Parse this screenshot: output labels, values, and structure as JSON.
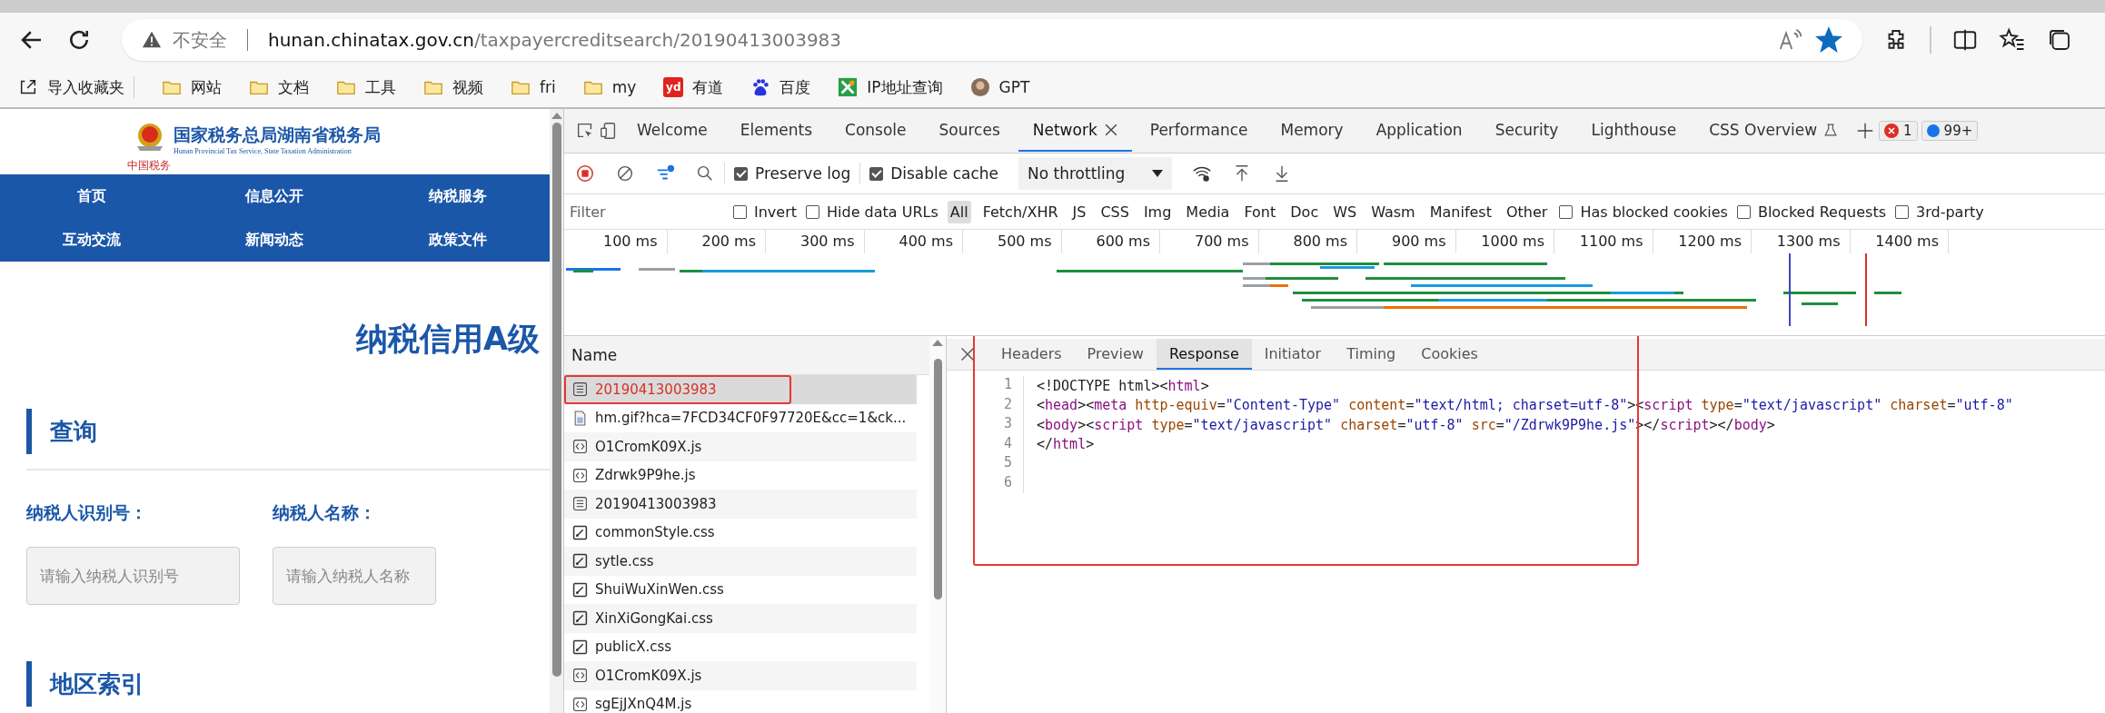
{
  "browser": {
    "security": "不安全",
    "url_host": "hunan.chinatax.gov.cn",
    "url_path": "/taxpayercreditsearch/20190413003983",
    "favorite": true
  },
  "bookmarks": [
    {
      "label": "导入收藏夹",
      "kind": "import"
    },
    {
      "label": "网站",
      "kind": "folder"
    },
    {
      "label": "文档",
      "kind": "folder"
    },
    {
      "label": "工具",
      "kind": "folder"
    },
    {
      "label": "视频",
      "kind": "folder"
    },
    {
      "label": "fri",
      "kind": "folder"
    },
    {
      "label": "my",
      "kind": "folder"
    },
    {
      "label": "有道",
      "kind": "youdao",
      "icon_text": "yd"
    },
    {
      "label": "百度",
      "kind": "baidu"
    },
    {
      "label": "IP地址查询",
      "kind": "ip"
    },
    {
      "label": "GPT",
      "kind": "avatar"
    }
  ],
  "site": {
    "title": "国家税务总局湖南省税务局",
    "subtitle": "Hunan Provincial  Tax Service,  State Taxation Administration",
    "logo_caption": "中国税务",
    "nav": [
      "首页",
      "信息公开",
      "纳税服务",
      "互动交流",
      "新闻动态",
      "政策文件"
    ],
    "heading": "纳税信用A级",
    "section": "查询",
    "fields": [
      {
        "label": "纳税人识别号：",
        "placeholder": "请输入纳税人识别号"
      },
      {
        "label": "纳税人名称：",
        "placeholder": "请输入纳税人名称"
      }
    ],
    "next_section": "地区索引"
  },
  "devtools": {
    "tabs": [
      {
        "label": "Welcome",
        "selected": false
      },
      {
        "label": "Elements",
        "selected": false
      },
      {
        "label": "Console",
        "selected": false
      },
      {
        "label": "Sources",
        "selected": false
      },
      {
        "label": "Network",
        "selected": true
      },
      {
        "label": "Performance",
        "selected": false
      },
      {
        "label": "Memory",
        "selected": false
      },
      {
        "label": "Application",
        "selected": false
      },
      {
        "label": "Security",
        "selected": false
      },
      {
        "label": "Lighthouse",
        "selected": false
      },
      {
        "label": "CSS Overview",
        "selected": false
      }
    ],
    "error_count": "1",
    "message_count": "99+",
    "toolbar": {
      "recording": true,
      "preserve_log": {
        "label": "Preserve log",
        "checked": true
      },
      "disable_cache": {
        "label": "Disable cache",
        "checked": true
      },
      "throttling": "No throttling"
    },
    "filter": {
      "placeholder": "Filter",
      "options": [
        {
          "label": "Invert",
          "checked": false
        },
        {
          "label": "Hide data URLs",
          "checked": false
        }
      ],
      "types": [
        {
          "label": "All",
          "selected": true
        },
        {
          "label": "Fetch/XHR",
          "selected": false
        },
        {
          "label": "JS",
          "selected": false
        },
        {
          "label": "CSS",
          "selected": false
        },
        {
          "label": "Img",
          "selected": false
        },
        {
          "label": "Media",
          "selected": false
        },
        {
          "label": "Font",
          "selected": false
        },
        {
          "label": "Doc",
          "selected": false
        },
        {
          "label": "WS",
          "selected": false
        },
        {
          "label": "Wasm",
          "selected": false
        },
        {
          "label": "Manifest",
          "selected": false
        },
        {
          "label": "Other",
          "selected": false
        }
      ],
      "extra": [
        {
          "label": "Has blocked cookies",
          "checked": false
        },
        {
          "label": "Blocked Requests",
          "checked": false
        },
        {
          "label": "3rd-party",
          "checked": false
        }
      ]
    },
    "timeline_ticks": [
      "100 ms",
      "200 ms",
      "300 ms",
      "400 ms",
      "500 ms",
      "600 ms",
      "700 ms",
      "800 ms",
      "900 ms",
      "1000 ms",
      "1100 ms",
      "1200 ms",
      "1300 ms",
      "1400 ms"
    ],
    "requests_header": "Name",
    "requests": [
      {
        "name": "20190413003983",
        "kind": "document",
        "selected": true,
        "failed": true,
        "marked": true
      },
      {
        "name": "hm.gif?hca=7FCD34CF0F97720E&cc=1&ck...",
        "kind": "image",
        "selected": false,
        "failed": false,
        "marked": false
      },
      {
        "name": "O1CromK09X.js",
        "kind": "script",
        "selected": false,
        "failed": false,
        "marked": false
      },
      {
        "name": "Zdrwk9P9he.js",
        "kind": "script",
        "selected": false,
        "failed": false,
        "marked": false
      },
      {
        "name": "20190413003983",
        "kind": "document",
        "selected": false,
        "failed": false,
        "marked": false
      },
      {
        "name": "commonStyle.css",
        "kind": "stylesheet",
        "selected": false,
        "failed": false,
        "marked": false
      },
      {
        "name": "sytle.css",
        "kind": "stylesheet",
        "selected": false,
        "failed": false,
        "marked": false
      },
      {
        "name": "ShuiWuXinWen.css",
        "kind": "stylesheet",
        "selected": false,
        "failed": false,
        "marked": false
      },
      {
        "name": "XinXiGongKai.css",
        "kind": "stylesheet",
        "selected": false,
        "failed": false,
        "marked": false
      },
      {
        "name": "publicX.css",
        "kind": "stylesheet",
        "selected": false,
        "failed": false,
        "marked": false
      },
      {
        "name": "O1CromK09X.js",
        "kind": "script",
        "selected": false,
        "failed": false,
        "marked": false
      },
      {
        "name": "sgEjJXnQ4M.js",
        "kind": "script",
        "selected": false,
        "failed": false,
        "marked": false
      }
    ],
    "detail": {
      "marked": true,
      "tabs": [
        {
          "label": "Headers",
          "selected": false
        },
        {
          "label": "Preview",
          "selected": false
        },
        {
          "label": "Response",
          "selected": true
        },
        {
          "label": "Initiator",
          "selected": false
        },
        {
          "label": "Timing",
          "selected": false
        },
        {
          "label": "Cookies",
          "selected": false
        }
      ],
      "lines": [
        {
          "number": "1",
          "tokens": [
            {
              "kind": "text",
              "text": "<!DOCTYPE html>"
            },
            {
              "kind": "punct",
              "text": "<"
            },
            {
              "kind": "tag",
              "text": "html"
            },
            {
              "kind": "punct",
              "text": ">"
            }
          ]
        },
        {
          "number": "2",
          "tokens": [
            {
              "kind": "punct",
              "text": "<"
            },
            {
              "kind": "tag",
              "text": "head"
            },
            {
              "kind": "punct",
              "text": "><"
            },
            {
              "kind": "tag",
              "text": "meta"
            },
            {
              "kind": "attr",
              "text": " http-equiv"
            },
            {
              "kind": "punct",
              "text": "="
            },
            {
              "kind": "value",
              "text": "\"Content-Type\""
            },
            {
              "kind": "attr",
              "text": " content"
            },
            {
              "kind": "punct",
              "text": "="
            },
            {
              "kind": "value",
              "text": "\"text/html; charset=utf-8\""
            },
            {
              "kind": "punct",
              "text": "><"
            },
            {
              "kind": "tag",
              "text": "script"
            },
            {
              "kind": "attr",
              "text": " type"
            },
            {
              "kind": "punct",
              "text": "="
            },
            {
              "kind": "value",
              "text": "\"text/javascript\""
            },
            {
              "kind": "attr",
              "text": " charset"
            },
            {
              "kind": "punct",
              "text": "="
            },
            {
              "kind": "value",
              "text": "\"utf-8\""
            }
          ]
        },
        {
          "number": "3",
          "tokens": [
            {
              "kind": "punct",
              "text": "<"
            },
            {
              "kind": "tag",
              "text": "body"
            },
            {
              "kind": "punct",
              "text": "><"
            },
            {
              "kind": "tag",
              "text": "script"
            },
            {
              "kind": "attr",
              "text": " type"
            },
            {
              "kind": "punct",
              "text": "="
            },
            {
              "kind": "value",
              "text": "\"text/javascript\""
            },
            {
              "kind": "attr",
              "text": " charset"
            },
            {
              "kind": "punct",
              "text": "="
            },
            {
              "kind": "value",
              "text": "\"utf-8\""
            },
            {
              "kind": "attr",
              "text": " src"
            },
            {
              "kind": "punct",
              "text": "="
            },
            {
              "kind": "value",
              "text": "\"/Zdrwk9P9he.js\""
            },
            {
              "kind": "punct",
              "text": "></"
            },
            {
              "kind": "tag",
              "text": "script"
            },
            {
              "kind": "punct",
              "text": "></"
            },
            {
              "kind": "tag",
              "text": "body"
            },
            {
              "kind": "punct",
              "text": ">"
            }
          ]
        },
        {
          "number": "4",
          "tokens": [
            {
              "kind": "punct",
              "text": "</"
            },
            {
              "kind": "tag",
              "text": "html"
            },
            {
              "kind": "punct",
              "text": ">"
            }
          ]
        },
        {
          "number": "5"
        },
        {
          "number": "6"
        }
      ]
    }
  }
}
